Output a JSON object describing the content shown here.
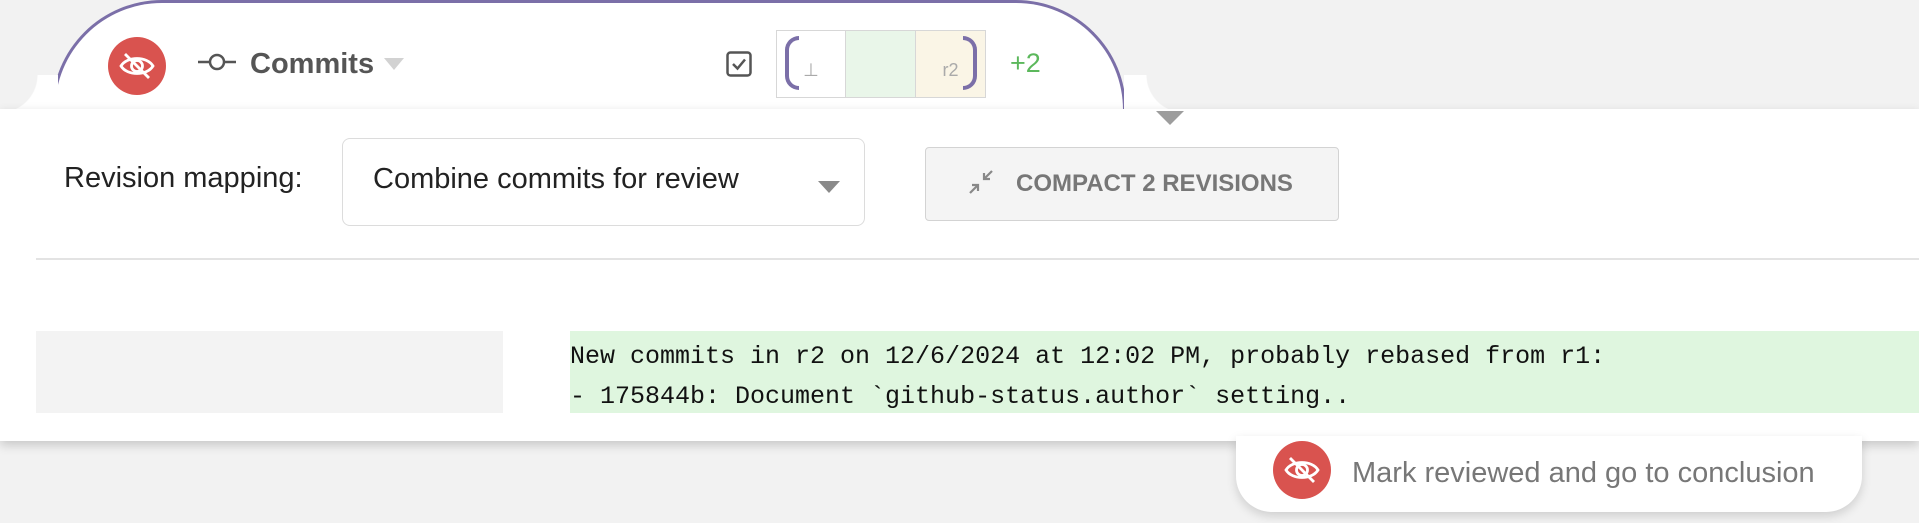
{
  "colors": {
    "accent": "#7b6fa8",
    "danger": "#d9534f",
    "success": "#5cb85c",
    "base_rev_bg": "#ffffff",
    "mid_rev_bg": "#e9f6e9",
    "r2_rev_bg": "#faf5e6",
    "commit_bg": "#dff6df"
  },
  "header": {
    "unreviewed_icon": "eye-slash-icon",
    "commit_icon": "git-commit-icon",
    "title": "Commits",
    "checkbox_icon": "checkbox-checked-icon",
    "revisions": [
      {
        "label": "⊥"
      },
      {
        "label": ""
      },
      {
        "label": "r2"
      }
    ],
    "extra_revisions": "+2"
  },
  "mapping": {
    "label": "Revision mapping:",
    "selected": "Combine commits for review"
  },
  "compact": {
    "icon": "compress-icon",
    "label": "COMPACT 2 REVISIONS"
  },
  "commit_message": {
    "lines": [
      "New commits in r2 on 12/6/2024 at 12:02 PM, probably rebased from r1:",
      "- 175844b: Document `github-status.author` setting.."
    ]
  },
  "footer": {
    "icon": "eye-slash-icon",
    "label": "Mark reviewed and go to conclusion"
  }
}
